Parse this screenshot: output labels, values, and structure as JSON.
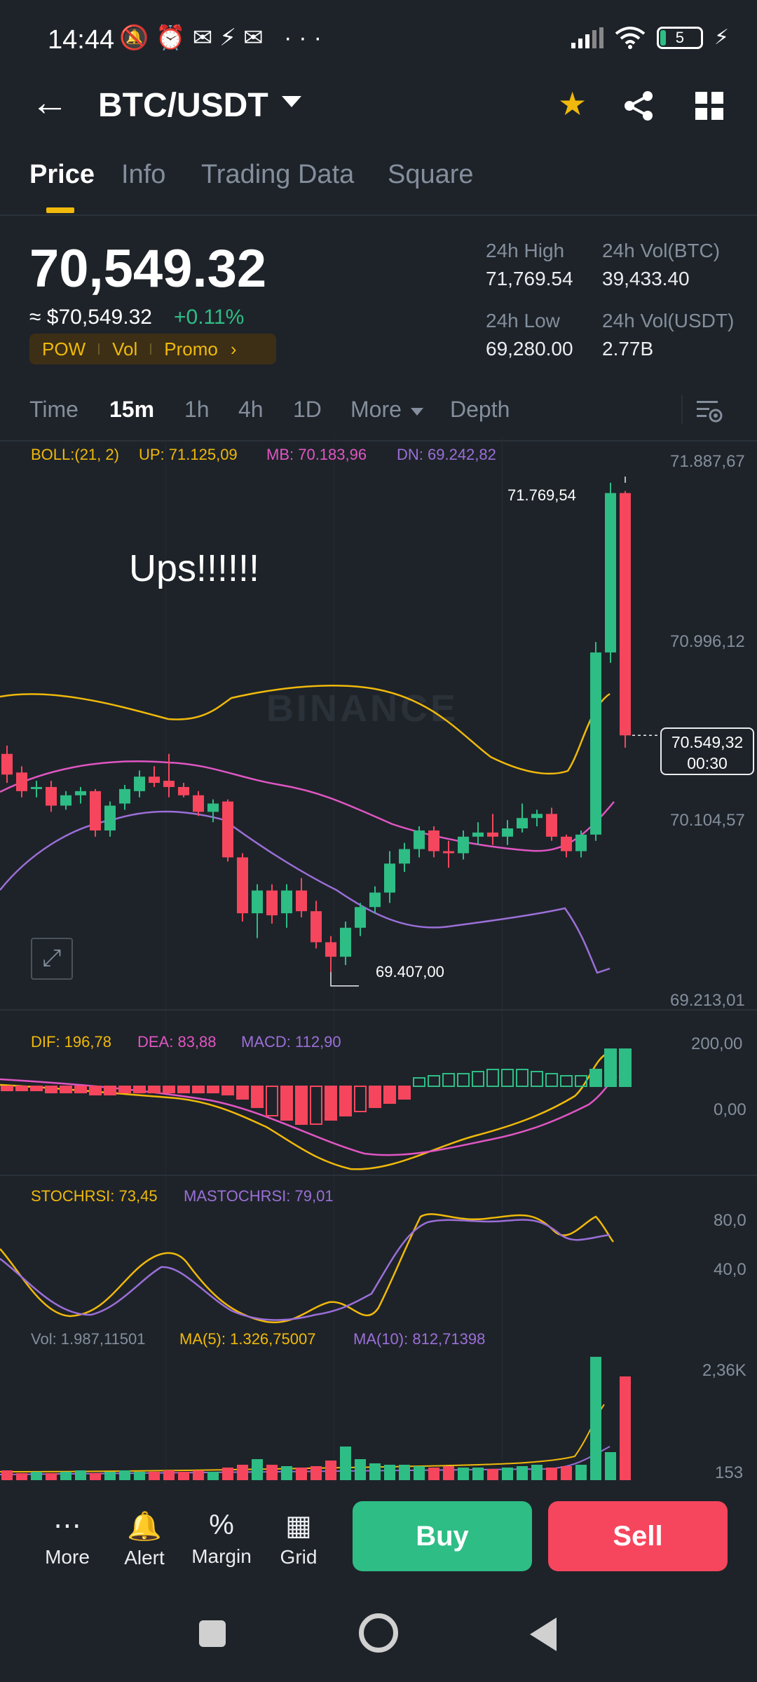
{
  "status": {
    "time": "14:44",
    "icons": "🔕⏰✉⚡✉ ···",
    "battery": "5"
  },
  "header": {
    "pair": "BTC/USDT"
  },
  "tabs": [
    "Price",
    "Info",
    "Trading Data",
    "Square"
  ],
  "price": {
    "last": "70,549.32",
    "usd": "≈ $70,549.32",
    "change": "+0.11%",
    "tags": [
      "POW",
      "Vol",
      "Promo"
    ],
    "stats": [
      {
        "label": "24h High",
        "value": "71,769.54"
      },
      {
        "label": "24h Vol(BTC)",
        "value": "39,433.40"
      },
      {
        "label": "24h Low",
        "value": "69,280.00"
      },
      {
        "label": "24h Vol(USDT)",
        "value": "2.77B"
      }
    ]
  },
  "intervals": [
    "Time",
    "15m",
    "1h",
    "4h",
    "1D",
    "More",
    "Depth"
  ],
  "boll": {
    "label": "BOLL:(21, 2)",
    "up": "UP: 71.125,09",
    "mb": "MB: 70.183,96",
    "dn": "DN: 69.242,82"
  },
  "price_axis": [
    "71.887,67",
    "70.996,12",
    "70.104,57",
    "69.213,01"
  ],
  "price_marker": {
    "price": "70.549,32",
    "countdown": "00:30"
  },
  "annotations": {
    "high": "71.769,54",
    "low": "69.407,00",
    "note": "Ups!!!!!!",
    "watermark": "BINANCE"
  },
  "macd": {
    "dif": "DIF: 196,78",
    "dea": "DEA: 83,88",
    "macd": "MACD: 112,90",
    "axis": [
      "200,00",
      "0,00"
    ]
  },
  "stoch": {
    "k": "STOCHRSI: 73,45",
    "d": "MASTOCHRSI: 79,01",
    "axis": [
      "80,0",
      "40,0"
    ]
  },
  "vol": {
    "vol": "Vol: 1.987,11501",
    "ma5": "MA(5): 1.326,75007",
    "ma10": "MA(10): 812,71398",
    "axis": [
      "2,36K",
      "153"
    ]
  },
  "bottom": {
    "items": [
      "More",
      "Alert",
      "Margin",
      "Grid"
    ],
    "buy": "Buy",
    "sell": "Sell"
  },
  "colors": {
    "up": "#2ebd85",
    "down": "#f6465d",
    "accent": "#f0b90b",
    "boll_up": "#f0b90b",
    "boll_mb": "#e056c3",
    "boll_dn": "#9b6fd8"
  },
  "chart_data": {
    "type": "candlestick",
    "interval": "15m",
    "candles": [
      [
        70460,
        70500,
        70320,
        70360
      ],
      [
        70370,
        70400,
        70250,
        70280
      ],
      [
        70290,
        70330,
        70250,
        70300
      ],
      [
        70300,
        70330,
        70180,
        70210
      ],
      [
        70210,
        70280,
        70190,
        70260
      ],
      [
        70260,
        70300,
        70220,
        70280
      ],
      [
        70280,
        70290,
        70060,
        70090
      ],
      [
        70090,
        70230,
        70060,
        70210
      ],
      [
        70220,
        70310,
        70190,
        70290
      ],
      [
        70280,
        70380,
        70250,
        70350
      ],
      [
        70350,
        70400,
        70300,
        70320
      ],
      [
        70330,
        70460,
        70250,
        70300
      ],
      [
        70300,
        70320,
        70250,
        70260
      ],
      [
        70260,
        70280,
        70160,
        70180
      ],
      [
        70180,
        70240,
        70130,
        70220
      ],
      [
        70230,
        70240,
        69940,
        69960
      ],
      [
        69960,
        69980,
        69650,
        69690
      ],
      [
        69690,
        69830,
        69570,
        69800
      ],
      [
        69800,
        69830,
        69640,
        69680
      ],
      [
        69690,
        69830,
        69620,
        69800
      ],
      [
        69800,
        69860,
        69670,
        69700
      ],
      [
        69700,
        69750,
        69520,
        69550
      ],
      [
        69550,
        69580,
        69407,
        69480
      ],
      [
        69480,
        69650,
        69440,
        69620
      ],
      [
        69620,
        69740,
        69580,
        69720
      ],
      [
        69720,
        69820,
        69690,
        69790
      ],
      [
        69790,
        69990,
        69740,
        69930
      ],
      [
        69930,
        70030,
        69890,
        70000
      ],
      [
        70000,
        70110,
        69960,
        70090
      ],
      [
        70090,
        70110,
        69960,
        69990
      ],
      [
        69990,
        70040,
        69910,
        69980
      ],
      [
        69980,
        70090,
        69950,
        70060
      ],
      [
        70060,
        70130,
        70020,
        70080
      ],
      [
        70080,
        70170,
        70020,
        70060
      ],
      [
        70060,
        70140,
        70020,
        70100
      ],
      [
        70100,
        70220,
        70080,
        70150
      ],
      [
        70150,
        70190,
        70110,
        70170
      ],
      [
        70170,
        70200,
        70040,
        70060
      ],
      [
        70060,
        70070,
        69960,
        69990
      ],
      [
        69990,
        70090,
        69960,
        70070
      ],
      [
        70070,
        71000,
        70040,
        70950
      ],
      [
        70950,
        71769.54,
        70900,
        71720
      ],
      [
        71720,
        71730,
        70490,
        70549.32
      ]
    ],
    "ylim": [
      69213.01,
      71887.67
    ],
    "y_ticks": [
      71887.67,
      70996.12,
      70104.57,
      69213.01
    ]
  }
}
